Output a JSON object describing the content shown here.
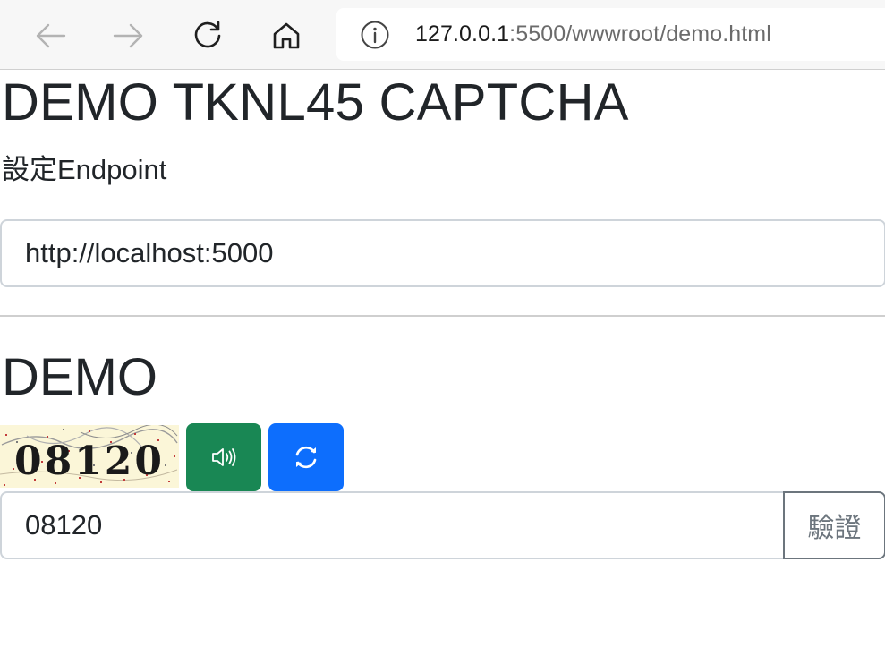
{
  "browser": {
    "back_icon": "arrow-left-icon",
    "forward_icon": "arrow-right-icon",
    "reload_icon": "reload-icon",
    "home_icon": "home-icon",
    "url_host": "127.0.0.1",
    "url_rest": ":5500/wwwroot/demo.html",
    "info_icon": "info-icon"
  },
  "page": {
    "title": "DEMO TKNL45 CAPTCHA",
    "endpoint_label": "設定Endpoint",
    "endpoint_value": "http://localhost:5000",
    "demo_heading": "DEMO"
  },
  "captcha": {
    "image_text": "08120",
    "audio_icon": "speaker-icon",
    "refresh_icon": "refresh-icon",
    "input_value": "08120",
    "verify_label": "驗證"
  },
  "colors": {
    "audio_button": "#198754",
    "refresh_button": "#0d6efd",
    "verify_border": "#6c757d"
  }
}
